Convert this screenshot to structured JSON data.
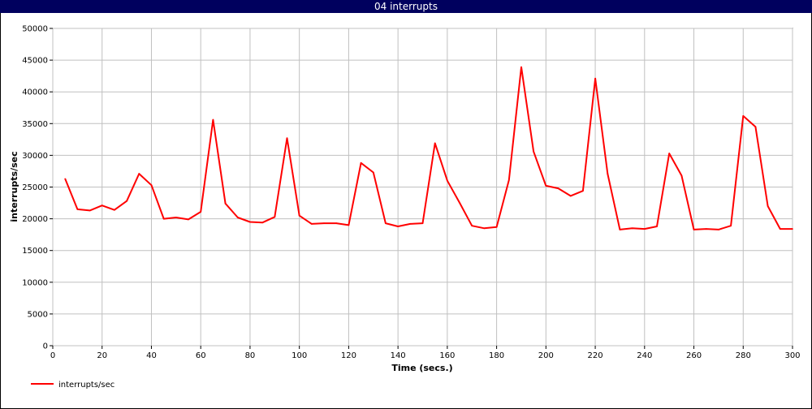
{
  "window": {
    "title": "04 interrupts"
  },
  "chart_data": {
    "type": "line",
    "title": "04 interrupts",
    "xlabel": "Time (secs.)",
    "ylabel": "interrupts/sec",
    "xlim": [
      0,
      300
    ],
    "ylim": [
      0,
      50000
    ],
    "xticks": [
      0,
      20,
      40,
      60,
      80,
      100,
      120,
      140,
      160,
      180,
      200,
      220,
      240,
      260,
      280,
      300
    ],
    "yticks": [
      0,
      5000,
      10000,
      15000,
      20000,
      25000,
      30000,
      35000,
      40000,
      45000,
      50000
    ],
    "grid": true,
    "legend_position": "bottom-left",
    "series": [
      {
        "name": "interrupts/sec",
        "color": "#ff0000",
        "x": [
          5,
          10,
          15,
          20,
          25,
          30,
          35,
          40,
          45,
          50,
          55,
          60,
          65,
          70,
          75,
          80,
          85,
          90,
          95,
          100,
          105,
          110,
          115,
          120,
          125,
          130,
          135,
          140,
          145,
          150,
          155,
          160,
          165,
          170,
          175,
          180,
          185,
          190,
          195,
          200,
          205,
          210,
          215,
          220,
          225,
          230,
          235,
          240,
          245,
          250,
          255,
          260,
          265,
          270,
          275,
          280,
          285,
          290,
          295,
          300
        ],
        "y": [
          26300,
          21500,
          21300,
          22100,
          21400,
          22800,
          27100,
          25300,
          20000,
          20200,
          19900,
          21100,
          35600,
          22400,
          20200,
          19500,
          19400,
          20300,
          32700,
          20500,
          19200,
          19300,
          19300,
          19000,
          28800,
          27300,
          19300,
          18800,
          19200,
          19300,
          31900,
          26000,
          22500,
          18900,
          18500,
          18700,
          26100,
          43900,
          30600,
          25200,
          24800,
          23600,
          24400,
          42100,
          27100,
          18300,
          18500,
          18400,
          18800,
          30300,
          26800,
          18300,
          18400,
          18300,
          18900,
          36200,
          34500,
          22000,
          18400,
          18400
        ]
      }
    ]
  }
}
